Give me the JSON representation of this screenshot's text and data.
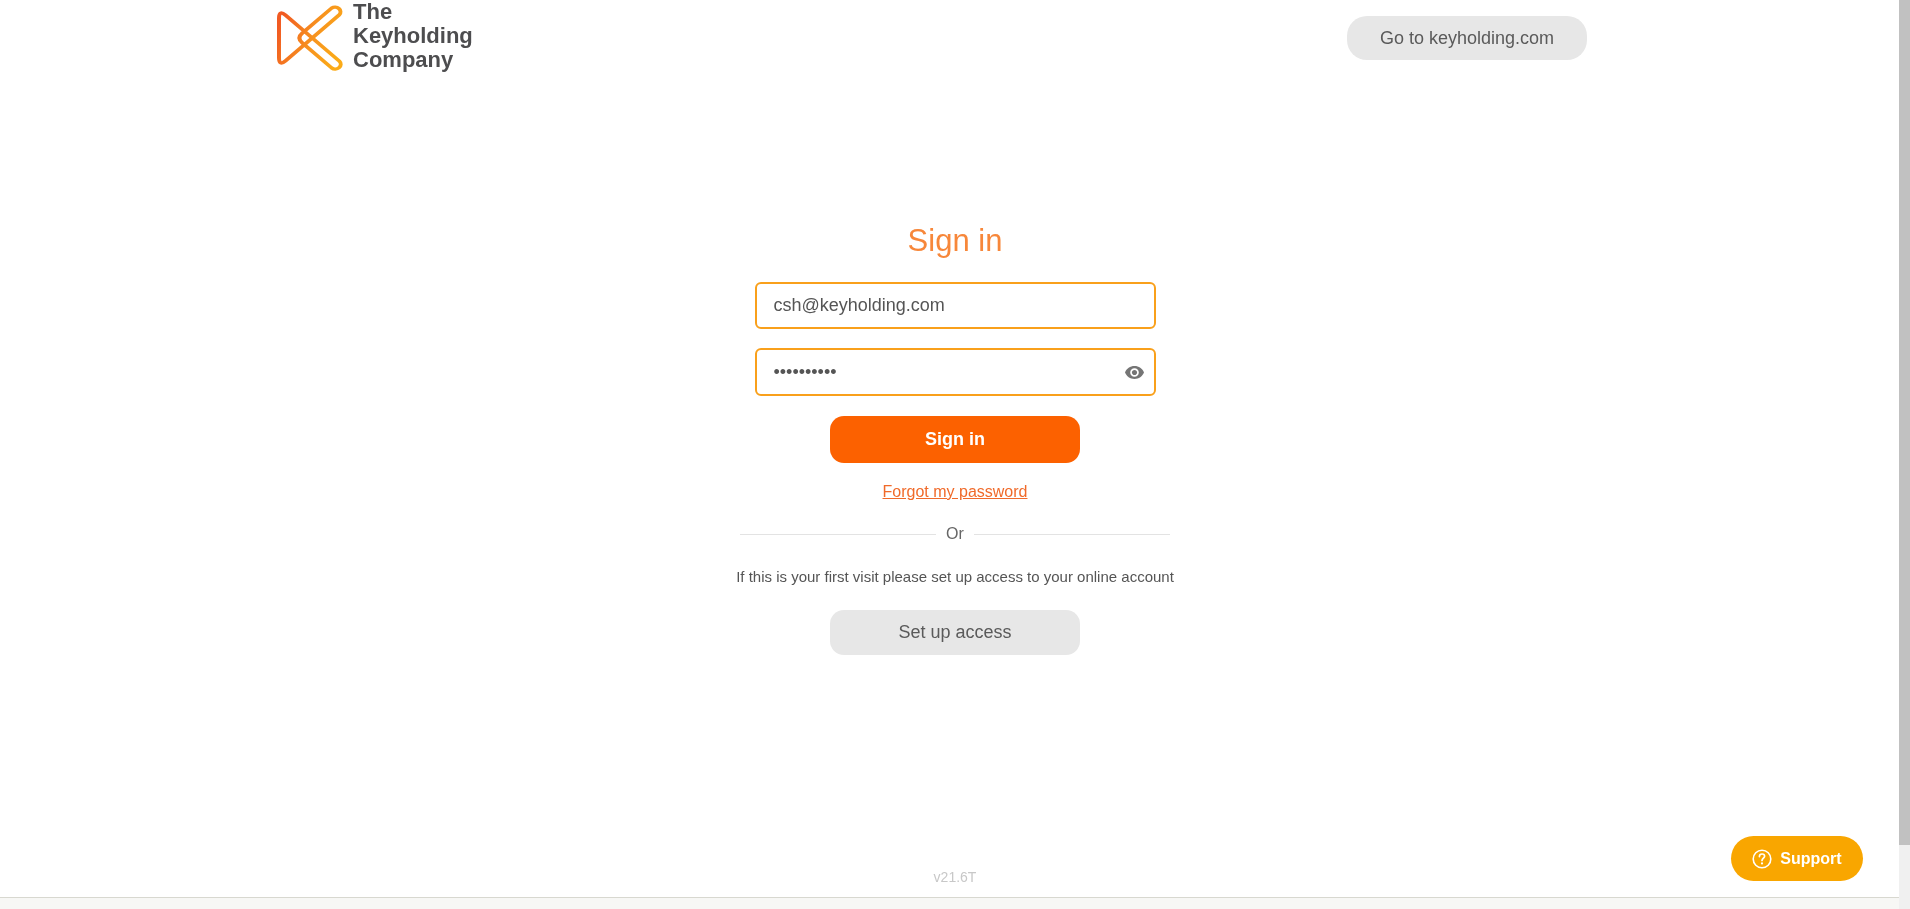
{
  "header": {
    "logo_text": [
      "The",
      "Keyholding",
      "Company"
    ],
    "site_button": {
      "label": "Go to keyholding.com"
    }
  },
  "sign_in_form": {
    "title": "Sign in",
    "email_field": {
      "value": "csh@keyholding.com"
    },
    "password_field": {
      "value": "••••••••••"
    },
    "submit_button": {
      "label": "Sign in"
    },
    "forgot_link": {
      "label": "Forgot my password"
    },
    "divider": {
      "label": "Or"
    },
    "first_visit_text": "If this is your first visit please set up access to your online account",
    "setup_button": {
      "label": "Set up access"
    }
  },
  "footer": {
    "version": "v21.6T"
  },
  "support_button": {
    "label": "Support"
  }
}
